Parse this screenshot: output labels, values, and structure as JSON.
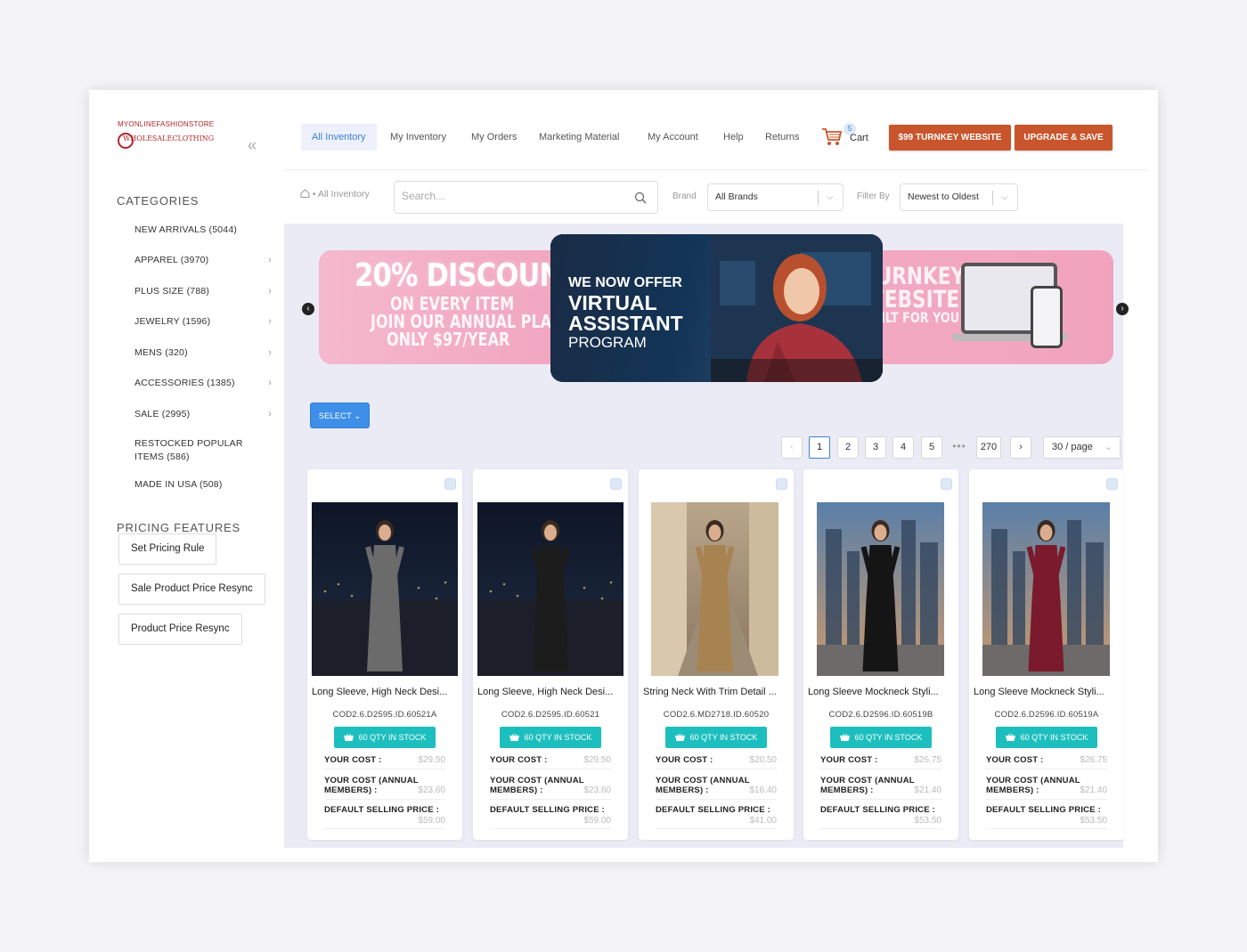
{
  "brand": {
    "logo_line1": "MYONLINEFASHIONSTORE",
    "logo_line2": "WHOLESALECLOTHING"
  },
  "sidebar": {
    "categories_title": "CATEGORIES",
    "categories": [
      {
        "label": "NEW ARRIVALS (5044)",
        "has_children": false
      },
      {
        "label": "APPAREL (3970)",
        "has_children": true
      },
      {
        "label": "PLUS SIZE (788)",
        "has_children": true
      },
      {
        "label": "JEWELRY (1596)",
        "has_children": true
      },
      {
        "label": "MENS (320)",
        "has_children": true
      },
      {
        "label": "ACCESSORIES (1385)",
        "has_children": true
      },
      {
        "label": "SALE (2995)",
        "has_children": true
      },
      {
        "label": "RESTOCKED POPULAR ITEMS (586)",
        "has_children": false
      },
      {
        "label": "MADE IN USA (508)",
        "has_children": false
      }
    ],
    "pricing_title": "PRICING FEATURES",
    "pricing_buttons": [
      "Set Pricing Rule",
      "Sale Product Price Resync",
      "Product Price Resync"
    ]
  },
  "nav": {
    "items": [
      "All Inventory",
      "My Inventory",
      "My Orders",
      "Marketing Material",
      "My Account",
      "Help",
      "Returns"
    ],
    "active_index": 0,
    "cart_label": "Cart",
    "cart_count": "5",
    "cta_turnkey": "$99 TURNKEY WEBSITE",
    "cta_upgrade": "UPGRADE & SAVE"
  },
  "filters": {
    "breadcrumb": "All Inventory",
    "search_placeholder": "Search...",
    "brand_label": "Brand",
    "brand_value": "All Brands",
    "filter_label": "Filter By",
    "filter_value": "Newest to Oldest"
  },
  "banners": {
    "left_big": "20% DISCOUNT",
    "left_sub1": "ON EVERY ITEM",
    "left_sub2": "JOIN OUR ANNUAL PLAN",
    "left_sub3": "ONLY $97/YEAR",
    "main_line1": "WE NOW OFFER",
    "main_line2": "VIRTUAL",
    "main_line3": "ASSISTANT",
    "main_line4": "PROGRAM",
    "right_line1": "TURNKEY",
    "right_line2": "WEBSITE",
    "right_line3": "BUILT FOR YOU"
  },
  "toolbar": {
    "select_label": "SELECT"
  },
  "pagination": {
    "pages": [
      "1",
      "2",
      "3",
      "4",
      "5"
    ],
    "current": "1",
    "ellipsis": "•••",
    "last": "270",
    "page_size": "30 / page"
  },
  "products": [
    {
      "name": "Long Sleeve, High Neck Desi...",
      "sku": "COD2.6.D2595.ID.60521A",
      "stock": "60 QTY IN STOCK",
      "your_cost_label": "YOUR COST :",
      "your_cost": "$29.50",
      "annual_label": "YOUR COST (ANNUAL MEMBERS) :",
      "annual_cost": "$23.60",
      "selling_label": "DEFAULT SELLING PRICE :",
      "selling_price": "$59.00",
      "dress_color": "#6b6b6b",
      "bg": "night"
    },
    {
      "name": "Long Sleeve, High Neck Desi...",
      "sku": "COD2.6.D2595.ID.60521",
      "stock": "60 QTY IN STOCK",
      "your_cost_label": "YOUR COST :",
      "your_cost": "$29.50",
      "annual_label": "YOUR COST (ANNUAL MEMBERS) :",
      "annual_cost": "$23.60",
      "selling_label": "DEFAULT SELLING PRICE :",
      "selling_price": "$59.00",
      "dress_color": "#1c1c1c",
      "bg": "night"
    },
    {
      "name": "String Neck With Trim Detail ...",
      "sku": "COD2.6.MD2718.ID.60520",
      "stock": "60 QTY IN STOCK",
      "your_cost_label": "YOUR COST :",
      "your_cost": "$20.50",
      "annual_label": "YOUR COST (ANNUAL MEMBERS) :",
      "annual_cost": "$16.40",
      "selling_label": "DEFAULT SELLING PRICE :",
      "selling_price": "$41.00",
      "dress_color": "#a88352",
      "bg": "street"
    },
    {
      "name": "Long Sleeve Mockneck Styli...",
      "sku": "COD2.6.D2596.ID.60519B",
      "stock": "60 QTY IN STOCK",
      "your_cost_label": "YOUR COST :",
      "your_cost": "$26.75",
      "annual_label": "YOUR COST (ANNUAL MEMBERS) :",
      "annual_cost": "$21.40",
      "selling_label": "DEFAULT SELLING PRICE :",
      "selling_price": "$53.50",
      "dress_color": "#151515",
      "bg": "city"
    },
    {
      "name": "Long Sleeve Mockneck Styli...",
      "sku": "COD2.6.D2596.ID.60519A",
      "stock": "60 QTY IN STOCK",
      "your_cost_label": "YOUR COST :",
      "your_cost": "$26.75",
      "annual_label": "YOUR COST (ANNUAL MEMBERS) :",
      "annual_cost": "$21.40",
      "selling_label": "DEFAULT SELLING PRICE :",
      "selling_price": "$53.50",
      "dress_color": "#7a1a2c",
      "bg": "city"
    }
  ],
  "colors": {
    "accent": "#3b82d6",
    "cta": "#c9552d",
    "stock": "#1dbfbe",
    "brand_red": "#b2262b"
  }
}
